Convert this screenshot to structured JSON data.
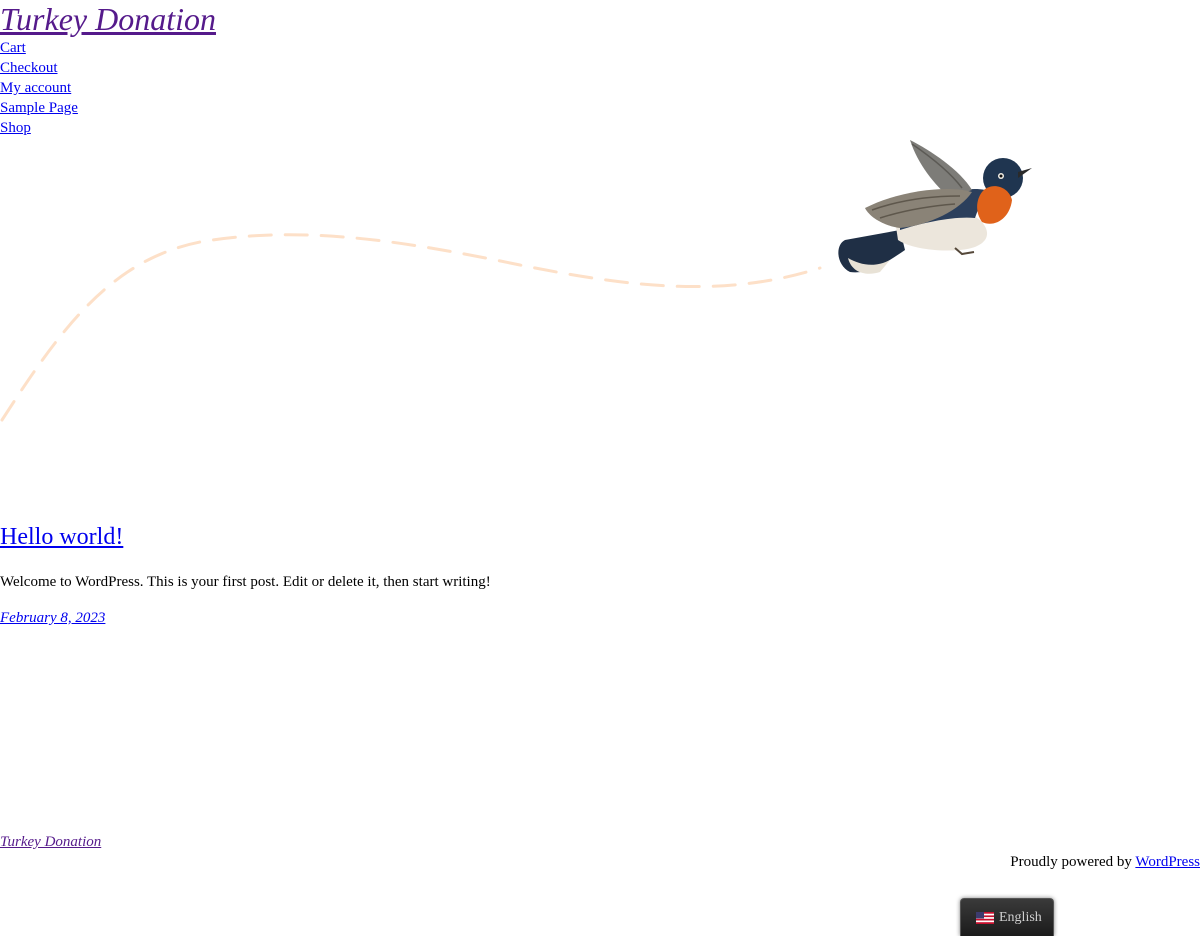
{
  "site": {
    "title": "Turkey Donation"
  },
  "nav": {
    "items": [
      {
        "label": "Cart"
      },
      {
        "label": "Checkout"
      },
      {
        "label": "My account"
      },
      {
        "label": "Sample Page"
      },
      {
        "label": "Shop"
      }
    ]
  },
  "hero": {
    "image": "flying-bird-illustration",
    "path_color": "#fde0c8"
  },
  "post": {
    "title": "Hello world!",
    "excerpt": "Welcome to WordPress. This is your first post. Edit or delete it, then start writing!",
    "date": "February 8, 2023"
  },
  "footer": {
    "site_title": "Turkey Donation",
    "powered_prefix": "Proudly powered by ",
    "powered_link": "WordPress"
  },
  "language_switcher": {
    "label": "English",
    "flag_icon": "us-flag-icon"
  }
}
